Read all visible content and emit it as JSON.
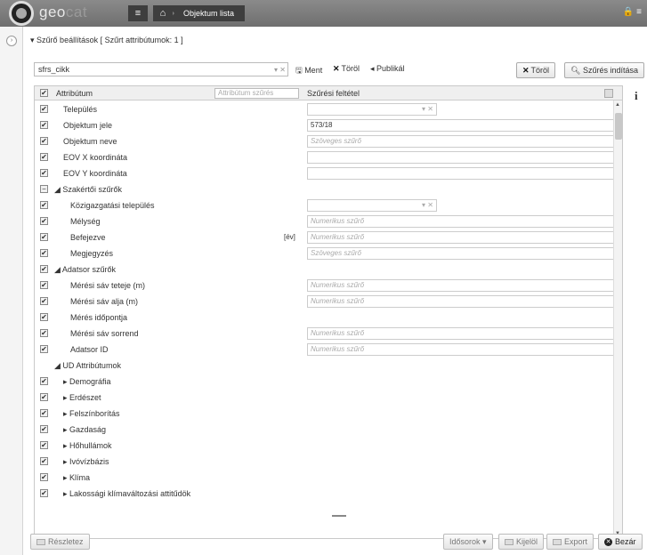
{
  "app": {
    "logo_text": "geo",
    "logo_faded": "cat",
    "breadcrumb": "Objektum lista",
    "menu_icon": "hamburger-icon",
    "home_icon": "home-icon",
    "top_right": "🔒 ≡"
  },
  "filter_header": {
    "toggle": "▾",
    "title": "Szűrő beállítások",
    "subtitle": "[ Szűrt attribútumok: 1 ]"
  },
  "search": {
    "value": "sfrs_cikk",
    "combo_ctrl": "▾ ✕"
  },
  "actions": {
    "save": "Ment",
    "delete": "Töröl",
    "publish": "Publikál",
    "clear": "Töröl",
    "start_filter": "Szűrés indítása"
  },
  "grid": {
    "col_attribute": "Attribútum",
    "col_filter_placeholder": "Attribútum szűrés",
    "col_condition": "Szűrési feltétel",
    "rows": [
      {
        "label": "Település",
        "level": 1,
        "check": "✔",
        "cond": "",
        "type": "combo"
      },
      {
        "label": "Objektum jele",
        "level": 1,
        "check": "✔",
        "cond": "573/18",
        "type": "text"
      },
      {
        "label": "Objektum neve",
        "level": 1,
        "check": "✔",
        "cond": "Szöveges szűrő",
        "type": "ph"
      },
      {
        "label": "EOV X koordináta",
        "level": 1,
        "check": "✔",
        "cond": "",
        "type": "text"
      },
      {
        "label": "EOV Y koordináta",
        "level": 1,
        "check": "✔",
        "cond": "",
        "type": "text"
      },
      {
        "label": "◢ Szakértői szűrők",
        "level": 0,
        "check": "−",
        "cond": "",
        "type": "none"
      },
      {
        "label": "Közigazgatási település",
        "level": 2,
        "check": "✔",
        "cond": "",
        "type": "combo"
      },
      {
        "label": "Mélység",
        "level": 2,
        "check": "✔",
        "cond": "Numerikus szűrő",
        "type": "ph"
      },
      {
        "label": "Befejezve",
        "level": 2,
        "check": "✔",
        "cond": "Numerikus szűrő",
        "type": "ph",
        "tag": "[év]"
      },
      {
        "label": "Megjegyzés",
        "level": 2,
        "check": "✔",
        "cond": "Szöveges szűrő",
        "type": "ph"
      },
      {
        "label": "◢ Adatsor szűrők",
        "level": 0,
        "check": "✔",
        "cond": "",
        "type": "none"
      },
      {
        "label": "Mérési sáv teteje (m)",
        "level": 2,
        "check": "✔",
        "cond": "Numerikus szűrő",
        "type": "ph"
      },
      {
        "label": "Mérési sáv alja (m)",
        "level": 2,
        "check": "✔",
        "cond": "Numerikus szűrő",
        "type": "ph"
      },
      {
        "label": "Mérés időpontja",
        "level": 2,
        "check": "✔",
        "cond": "",
        "type": "none"
      },
      {
        "label": "Mérési sáv sorrend",
        "level": 2,
        "check": "✔",
        "cond": "Numerikus szűrő",
        "type": "ph"
      },
      {
        "label": "Adatsor ID",
        "level": 2,
        "check": "✔",
        "cond": "Numerikus szűrő",
        "type": "ph"
      },
      {
        "label": "◢ UD Attribútumok",
        "level": 0,
        "check": "",
        "cond": "",
        "type": "none"
      },
      {
        "label": "▸ Demográfia",
        "level": 1,
        "check": "✔",
        "cond": "",
        "type": "none"
      },
      {
        "label": "▸ Erdészet",
        "level": 1,
        "check": "✔",
        "cond": "",
        "type": "none"
      },
      {
        "label": "▸ Felszínborítás",
        "level": 1,
        "check": "✔",
        "cond": "",
        "type": "none"
      },
      {
        "label": "▸ Gazdaság",
        "level": 1,
        "check": "✔",
        "cond": "",
        "type": "none"
      },
      {
        "label": "▸ Hőhullámok",
        "level": 1,
        "check": "✔",
        "cond": "",
        "type": "none"
      },
      {
        "label": "▸ Ivóvízbázis",
        "level": 1,
        "check": "✔",
        "cond": "",
        "type": "none"
      },
      {
        "label": "▸ Klíma",
        "level": 1,
        "check": "✔",
        "cond": "",
        "type": "none"
      },
      {
        "label": "▸ Lakossági klímaváltozási attitűdök",
        "level": 1,
        "check": "✔",
        "cond": "",
        "type": "none"
      }
    ]
  },
  "footer": {
    "details": "Részletez",
    "timeseries": "Idősorok ▾",
    "select": "Kijelöl",
    "export": "Export",
    "close": "Bezár"
  }
}
